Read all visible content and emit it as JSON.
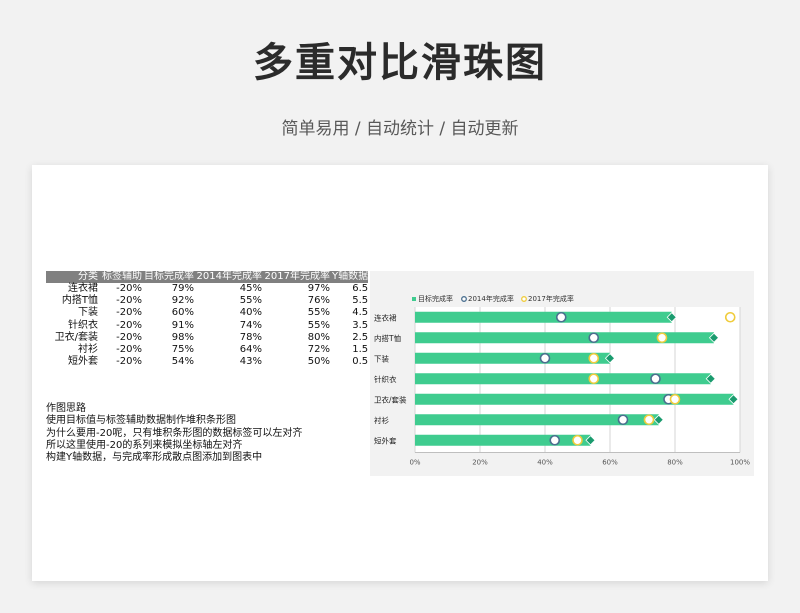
{
  "header": {
    "title": "多重对比滑珠图",
    "subtitle": "简单易用 / 自动统计 / 自动更新"
  },
  "table": {
    "headers": [
      "分类",
      "标签辅助",
      "目标完成率",
      "2014年完成率",
      "2017年完成率",
      "Y轴数据"
    ],
    "rows": [
      [
        "连衣裙",
        "-20%",
        "79%",
        "45%",
        "97%",
        "6.5"
      ],
      [
        "内搭T恤",
        "-20%",
        "92%",
        "55%",
        "76%",
        "5.5"
      ],
      [
        "下装",
        "-20%",
        "60%",
        "40%",
        "55%",
        "4.5"
      ],
      [
        "针织衣",
        "-20%",
        "91%",
        "74%",
        "55%",
        "3.5"
      ],
      [
        "卫衣/套装",
        "-20%",
        "98%",
        "78%",
        "80%",
        "2.5"
      ],
      [
        "衬衫",
        "-20%",
        "75%",
        "64%",
        "72%",
        "1.5"
      ],
      [
        "短外套",
        "-20%",
        "54%",
        "43%",
        "50%",
        "0.5"
      ]
    ]
  },
  "notes": [
    "作图思路",
    "使用目标值与标签辅助数据制作堆积条形图",
    "为什么要用-20呢，只有堆积条形图的数据标签可以左对齐",
    "所以这里使用-20的系列来模拟坐标轴左对齐",
    "构建Y轴数据，与完成率形成散点图添加到图表中"
  ],
  "chart_data": {
    "type": "bar",
    "categories": [
      "连衣裙",
      "内搭T恤",
      "下装",
      "针织衣",
      "卫衣/套装",
      "衬衫",
      "短外套"
    ],
    "series": [
      {
        "name": "目标完成率",
        "values": [
          79,
          92,
          60,
          91,
          98,
          75,
          54
        ],
        "color": "#3fcc8f",
        "marker": "bar+diamond",
        "marker_color": "#1a9b6e"
      },
      {
        "name": "2014年完成率",
        "values": [
          45,
          55,
          40,
          74,
          78,
          64,
          43
        ],
        "color": "#4a6f8f",
        "marker": "circle"
      },
      {
        "name": "2017年完成率",
        "values": [
          97,
          76,
          55,
          55,
          80,
          72,
          50
        ],
        "color": "#f0cc3c",
        "marker": "circle"
      }
    ],
    "x_ticks": [
      "0%",
      "20%",
      "40%",
      "60%",
      "80%",
      "100%"
    ],
    "xlim": [
      0,
      100
    ],
    "legend_position": "top-left",
    "grid": true,
    "background": "#f2f2f2"
  }
}
